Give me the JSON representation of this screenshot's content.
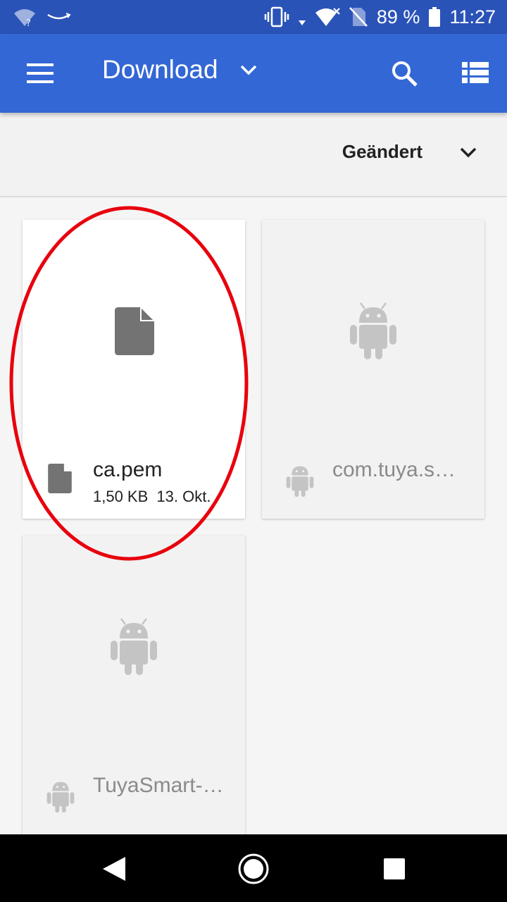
{
  "status_bar": {
    "battery": "89 %",
    "time": "11:27",
    "icons": [
      "wifi-unknown-icon",
      "amazon-icon",
      "vibrate-icon",
      "signal-icon",
      "wifi-icon",
      "no-sim-icon",
      "battery-icon"
    ]
  },
  "app_bar": {
    "title": "Download",
    "icons": [
      "menu-icon",
      "chevron-down-icon",
      "search-icon",
      "list-view-icon"
    ]
  },
  "sort_bar": {
    "label": "Geändert",
    "icon": "chevron-down-icon"
  },
  "files": [
    {
      "name": "ca.pem",
      "size": "1,50 KB",
      "date": "13. Okt.",
      "type": "document",
      "icon": "document-icon"
    },
    {
      "name": "com.tuya.s…",
      "type": "apk",
      "icon": "android-icon"
    },
    {
      "name": "TuyaSmart-…",
      "type": "apk",
      "icon": "android-icon"
    }
  ],
  "annotation": {
    "shape": "ellipse",
    "color": "#e8000d"
  },
  "nav_bar": {
    "icons": [
      "back-icon",
      "home-icon",
      "recents-icon"
    ]
  },
  "colors": {
    "status_bar": "#2a53b8",
    "app_bar": "#3367d6",
    "background": "#f5f5f5"
  }
}
